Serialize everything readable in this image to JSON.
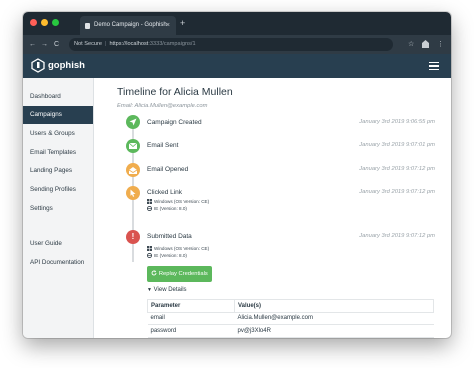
{
  "browser": {
    "tab_title": "Demo Campaign - Gophish",
    "tab_close": "×",
    "new_tab": "+",
    "back": "←",
    "forward": "→",
    "reload": "C",
    "not_secure": "Not Secure",
    "url_scheme": "https://",
    "url_host": "localhost",
    "url_path": ":3333/campaigns/1",
    "star": "☆",
    "menu": "⋮",
    "dots": [
      "#ff5f57",
      "#febc2e",
      "#28c840"
    ]
  },
  "app": {
    "brand": "gophish"
  },
  "sidebar": {
    "items": [
      {
        "label": "Dashboard"
      },
      {
        "label": "Campaigns"
      },
      {
        "label": "Users & Groups"
      },
      {
        "label": "Email Templates"
      },
      {
        "label": "Landing Pages"
      },
      {
        "label": "Sending Profiles"
      },
      {
        "label": "Settings"
      },
      {
        "label": "User Guide"
      },
      {
        "label": "API Documentation"
      }
    ],
    "active": "Campaigns"
  },
  "timeline": {
    "title": "Timeline for Alicia Mullen",
    "email": "Email: Alicia.Mullen@example.com",
    "events": [
      {
        "title": "Campaign Created",
        "time": "January 3rd 2019 9:06:55 pm",
        "icon": "rocket-icon",
        "color": "#5cb85c"
      },
      {
        "title": "Email Sent",
        "time": "January 3rd 2019 9:07:01 pm",
        "icon": "envelope-icon",
        "color": "#5cb85c"
      },
      {
        "title": "Email Opened",
        "time": "January 3rd 2019 9:07:12 pm",
        "icon": "envelope-open-icon",
        "color": "#f0ad4e"
      },
      {
        "title": "Clicked Link",
        "time": "January 3rd 2019 9:07:12 pm",
        "icon": "pointer-icon",
        "color": "#f0ad4e",
        "details": [
          "Windows (OS Version: CE)",
          "IE (Version: 8.0)"
        ]
      },
      {
        "title": "Submitted Data",
        "time": "January 3rd 2019 9:07:12 pm",
        "icon": "exclamation-icon",
        "color": "#d9534f",
        "details": [
          "Windows (OS Version: CE)",
          "IE (Version: 8.0)"
        ]
      }
    ],
    "replay_button": "Replay Credentials",
    "view_details": "View Details",
    "table": {
      "headers": [
        "Parameter",
        "Value(s)"
      ],
      "rows": [
        [
          "email",
          "Alicia.Mullen@example.com"
        ],
        [
          "password",
          "pv@j3Xlo4R"
        ]
      ]
    }
  }
}
